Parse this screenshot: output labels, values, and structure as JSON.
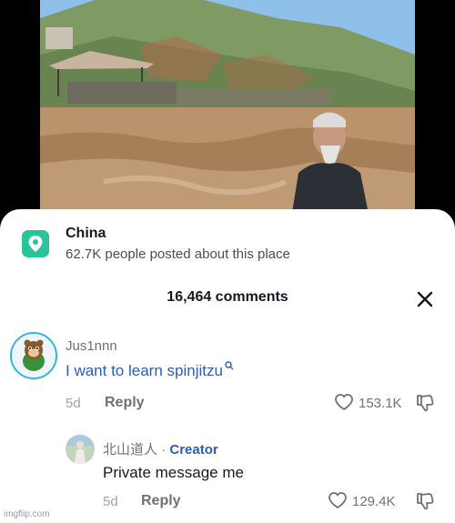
{
  "video": {
    "colors": {
      "sky": "#7eb6e8",
      "mountain": "#6e8a5a",
      "water": "#b08a62",
      "robe": "#2b2f36"
    }
  },
  "place": {
    "icon": "location-pin-icon",
    "name": "China",
    "subtitle": "62.7K people posted about this place",
    "accent": "#2bc49a"
  },
  "comments_panel": {
    "title": "16,464 comments",
    "close_icon": "close-icon"
  },
  "comments": [
    {
      "username": "Jus1nnn",
      "text": "I want to learn spinjitzu",
      "search_icon": "search-icon",
      "date": "5d",
      "reply_label": "Reply",
      "likes": "153.1K",
      "avatar_icon": "chipmunk-avatar"
    },
    {
      "username": "北山道人",
      "separator": "·",
      "creator_label": "Creator",
      "text": "Private message me",
      "date": "5d",
      "reply_label": "Reply",
      "likes": "129.4K",
      "avatar_icon": "creator-avatar"
    }
  ],
  "watermark": "imgflip.com",
  "colors": {
    "link": "#2b5db7",
    "muted": "#6f7177",
    "accent_ring": "#2db7e0"
  }
}
